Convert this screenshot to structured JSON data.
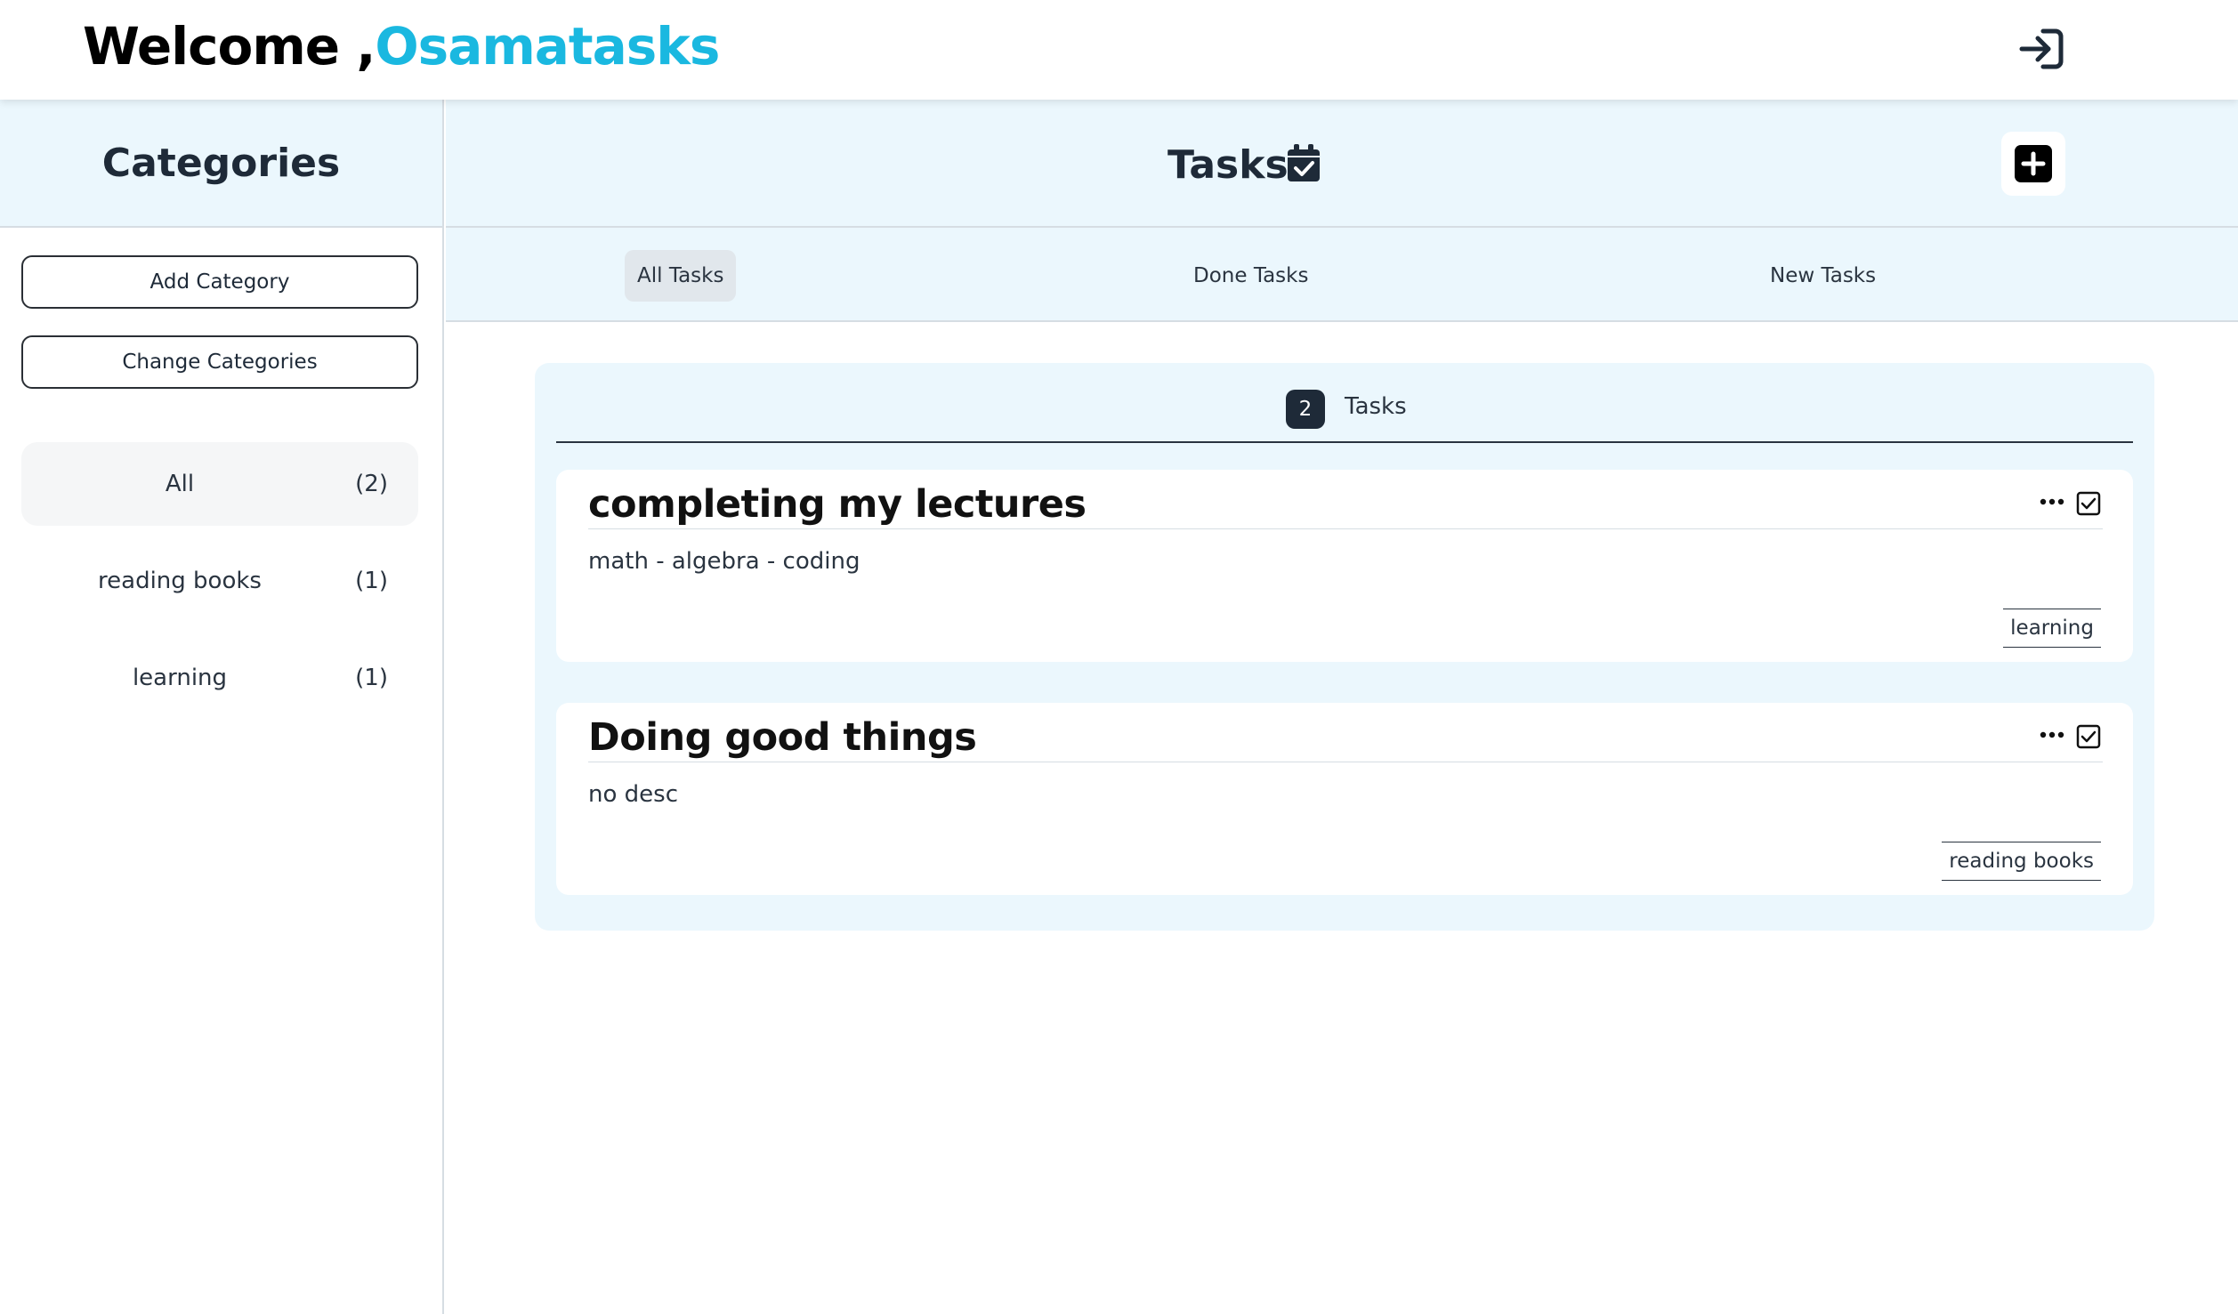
{
  "header": {
    "welcome_prefix": "Welcome ,",
    "username": "Osamatasks"
  },
  "sidebar": {
    "title": "Categories",
    "add_category_label": "Add Category",
    "change_categories_label": "Change Categories",
    "categories": [
      {
        "name": "All",
        "count": "(2)",
        "active": true
      },
      {
        "name": "reading books",
        "count": "(1)",
        "active": false
      },
      {
        "name": "learning",
        "count": "(1)",
        "active": false
      }
    ]
  },
  "main": {
    "title": "Tasks",
    "tabs": [
      {
        "label": "All Tasks",
        "active": true
      },
      {
        "label": "Done Tasks",
        "active": false
      },
      {
        "label": "New Tasks",
        "active": false
      }
    ],
    "task_count": "2",
    "task_count_label": "Tasks",
    "tasks": [
      {
        "title": "completing my lectures",
        "description": "math - algebra - coding",
        "category": "learning"
      },
      {
        "title": "Doing good things",
        "description": "no desc",
        "category": "reading books"
      }
    ]
  },
  "colors": {
    "accent": "#1ab8e0",
    "panel_bg": "#ebf7fd",
    "dark": "#1e2a38"
  },
  "icons": {
    "logout": "logout-arrow-icon",
    "calendar": "calendar-check-icon",
    "add": "plus-square-icon",
    "more": "ellipsis-icon",
    "done": "check-square-icon"
  }
}
